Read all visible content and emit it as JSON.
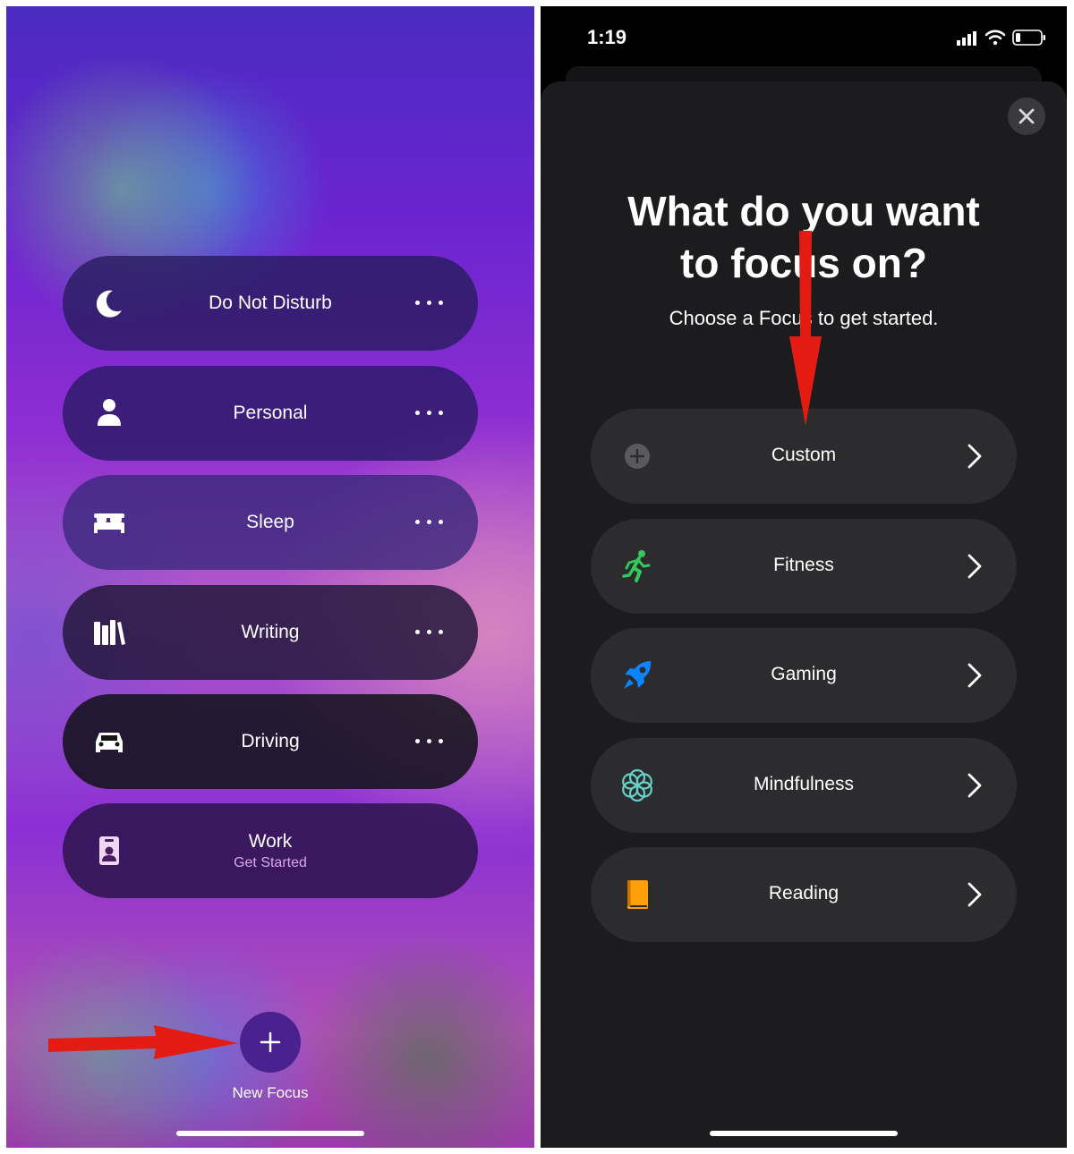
{
  "left_screen": {
    "focus_items": [
      {
        "label": "Do Not Disturb",
        "icon": "moon-icon"
      },
      {
        "label": "Personal",
        "icon": "person-icon"
      },
      {
        "label": "Sleep",
        "icon": "bed-icon"
      },
      {
        "label": "Writing",
        "icon": "books-icon"
      },
      {
        "label": "Driving",
        "icon": "car-icon"
      },
      {
        "label": "Work",
        "subtitle": "Get Started",
        "icon": "badge-icon"
      }
    ],
    "new_focus": {
      "label": "New Focus",
      "icon": "plus-icon"
    },
    "accent_subtitle_color": "#d8a8e8"
  },
  "right_screen": {
    "status_bar": {
      "time": "1:19"
    },
    "heading_line1": "What do you want",
    "heading_line2": "to focus on?",
    "subheading": "Choose a Focus to get started.",
    "options": [
      {
        "label": "Custom",
        "icon": "plus-circle-icon",
        "icon_color": "#8e8e93"
      },
      {
        "label": "Fitness",
        "icon": "running-figure-icon",
        "icon_color": "#34c759"
      },
      {
        "label": "Gaming",
        "icon": "rocket-icon",
        "icon_color": "#0a84ff"
      },
      {
        "label": "Mindfulness",
        "icon": "flower-icon",
        "icon_color": "#64d2c8"
      },
      {
        "label": "Reading",
        "icon": "book-icon",
        "icon_color": "#ff9f0a"
      }
    ],
    "annotation_color": "#e31b12"
  }
}
